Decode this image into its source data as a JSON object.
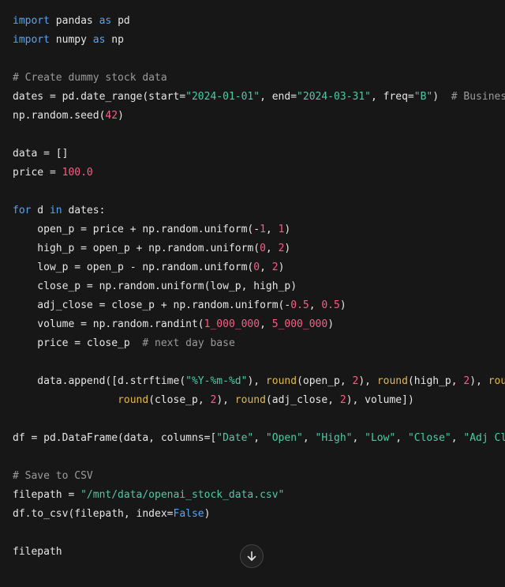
{
  "code": {
    "lines": [
      [
        {
          "t": "kw",
          "v": "import"
        },
        {
          "t": "plain",
          "v": " pandas "
        },
        {
          "t": "kw",
          "v": "as"
        },
        {
          "t": "plain",
          "v": " pd"
        }
      ],
      [
        {
          "t": "kw",
          "v": "import"
        },
        {
          "t": "plain",
          "v": " numpy "
        },
        {
          "t": "kw",
          "v": "as"
        },
        {
          "t": "plain",
          "v": " np"
        }
      ],
      [],
      [
        {
          "t": "com",
          "v": "# Create dummy stock data"
        }
      ],
      [
        {
          "t": "plain",
          "v": "dates = pd.date_range(start="
        },
        {
          "t": "str",
          "v": "\"2024-01-01\""
        },
        {
          "t": "plain",
          "v": ", end="
        },
        {
          "t": "str",
          "v": "\"2024-03-31\""
        },
        {
          "t": "plain",
          "v": ", freq="
        },
        {
          "t": "str",
          "v": "\"B\""
        },
        {
          "t": "plain",
          "v": ")  "
        },
        {
          "t": "com",
          "v": "# Business"
        }
      ],
      [
        {
          "t": "plain",
          "v": "np.random.seed("
        },
        {
          "t": "num",
          "v": "42"
        },
        {
          "t": "plain",
          "v": ")"
        }
      ],
      [],
      [
        {
          "t": "plain",
          "v": "data = []"
        }
      ],
      [
        {
          "t": "plain",
          "v": "price = "
        },
        {
          "t": "num",
          "v": "100.0"
        }
      ],
      [],
      [
        {
          "t": "kw",
          "v": "for"
        },
        {
          "t": "plain",
          "v": " d "
        },
        {
          "t": "kw",
          "v": "in"
        },
        {
          "t": "plain",
          "v": " dates:"
        }
      ],
      [
        {
          "t": "plain",
          "v": "    open_p = price + np.random.uniform(-"
        },
        {
          "t": "num",
          "v": "1"
        },
        {
          "t": "plain",
          "v": ", "
        },
        {
          "t": "num",
          "v": "1"
        },
        {
          "t": "plain",
          "v": ")"
        }
      ],
      [
        {
          "t": "plain",
          "v": "    high_p = open_p + np.random.uniform("
        },
        {
          "t": "num",
          "v": "0"
        },
        {
          "t": "plain",
          "v": ", "
        },
        {
          "t": "num",
          "v": "2"
        },
        {
          "t": "plain",
          "v": ")"
        }
      ],
      [
        {
          "t": "plain",
          "v": "    low_p = open_p - np.random.uniform("
        },
        {
          "t": "num",
          "v": "0"
        },
        {
          "t": "plain",
          "v": ", "
        },
        {
          "t": "num",
          "v": "2"
        },
        {
          "t": "plain",
          "v": ")"
        }
      ],
      [
        {
          "t": "plain",
          "v": "    close_p = np.random.uniform(low_p, high_p)"
        }
      ],
      [
        {
          "t": "plain",
          "v": "    adj_close = close_p + np.random.uniform(-"
        },
        {
          "t": "num",
          "v": "0.5"
        },
        {
          "t": "plain",
          "v": ", "
        },
        {
          "t": "num",
          "v": "0.5"
        },
        {
          "t": "plain",
          "v": ")"
        }
      ],
      [
        {
          "t": "plain",
          "v": "    volume = np.random.randint("
        },
        {
          "t": "num",
          "v": "1_000_000"
        },
        {
          "t": "plain",
          "v": ", "
        },
        {
          "t": "num",
          "v": "5_000_000"
        },
        {
          "t": "plain",
          "v": ")"
        }
      ],
      [
        {
          "t": "plain",
          "v": "    price = close_p  "
        },
        {
          "t": "com",
          "v": "# next day base"
        }
      ],
      [],
      [
        {
          "t": "plain",
          "v": "    data.append([d.strftime("
        },
        {
          "t": "str",
          "v": "\"%Y-%m-%d\""
        },
        {
          "t": "plain",
          "v": "), "
        },
        {
          "t": "fn",
          "v": "round"
        },
        {
          "t": "plain",
          "v": "(open_p, "
        },
        {
          "t": "num",
          "v": "2"
        },
        {
          "t": "plain",
          "v": "), "
        },
        {
          "t": "fn",
          "v": "round"
        },
        {
          "t": "plain",
          "v": "(high_p, "
        },
        {
          "t": "num",
          "v": "2"
        },
        {
          "t": "plain",
          "v": "), "
        },
        {
          "t": "fn",
          "v": "roun"
        }
      ],
      [
        {
          "t": "plain",
          "v": "                 "
        },
        {
          "t": "fn",
          "v": "round"
        },
        {
          "t": "plain",
          "v": "(close_p, "
        },
        {
          "t": "num",
          "v": "2"
        },
        {
          "t": "plain",
          "v": "), "
        },
        {
          "t": "fn",
          "v": "round"
        },
        {
          "t": "plain",
          "v": "(adj_close, "
        },
        {
          "t": "num",
          "v": "2"
        },
        {
          "t": "plain",
          "v": "), volume])"
        }
      ],
      [],
      [
        {
          "t": "plain",
          "v": "df = pd.DataFrame(data, columns=["
        },
        {
          "t": "str",
          "v": "\"Date\""
        },
        {
          "t": "plain",
          "v": ", "
        },
        {
          "t": "str",
          "v": "\"Open\""
        },
        {
          "t": "plain",
          "v": ", "
        },
        {
          "t": "str",
          "v": "\"High\""
        },
        {
          "t": "plain",
          "v": ", "
        },
        {
          "t": "str",
          "v": "\"Low\""
        },
        {
          "t": "plain",
          "v": ", "
        },
        {
          "t": "str",
          "v": "\"Close\""
        },
        {
          "t": "plain",
          "v": ", "
        },
        {
          "t": "str",
          "v": "\"Adj Clo"
        }
      ],
      [],
      [
        {
          "t": "com",
          "v": "# Save to CSV"
        }
      ],
      [
        {
          "t": "plain",
          "v": "filepath = "
        },
        {
          "t": "str",
          "v": "\"/mnt/data/openai_stock_data.csv\""
        }
      ],
      [
        {
          "t": "plain",
          "v": "df.to_csv(filepath, index="
        },
        {
          "t": "kw",
          "v": "False"
        },
        {
          "t": "plain",
          "v": ")"
        }
      ],
      [],
      [
        {
          "t": "plain",
          "v": "filepath"
        }
      ]
    ]
  },
  "scroll_button": {
    "icon": "arrow-down-icon"
  },
  "colors": {
    "background": "#171717",
    "keyword": "#5aa2f5",
    "string": "#4fc9a5",
    "number": "#f45f86",
    "comment": "#9b9b9b",
    "builtin": "#e3b84c",
    "text": "#e6e6e6"
  }
}
